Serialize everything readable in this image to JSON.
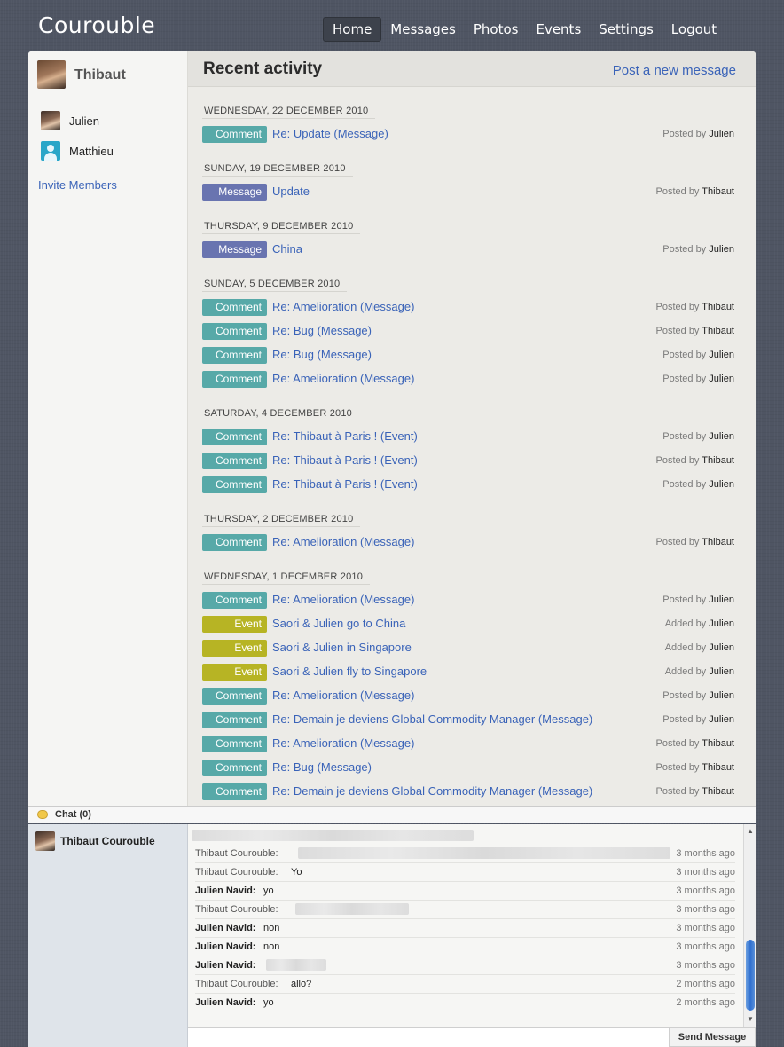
{
  "app": {
    "title": "Courouble"
  },
  "nav": [
    "Home",
    "Messages",
    "Photos",
    "Events",
    "Settings",
    "Logout"
  ],
  "nav_active": "Home",
  "sidebar": {
    "user": "Thibaut",
    "members": [
      "Julien",
      "Matthieu"
    ],
    "invite_label": "Invite Members"
  },
  "content": {
    "title": "Recent activity",
    "post_link": "Post a new message"
  },
  "days": [
    {
      "date": "WEDNESDAY, 22 DECEMBER 2010",
      "items": [
        {
          "type": "Comment",
          "title": "Re: Update (Message)",
          "verb": "Posted by",
          "author": "Julien"
        }
      ]
    },
    {
      "date": "SUNDAY, 19 DECEMBER 2010",
      "items": [
        {
          "type": "Message",
          "title": "Update",
          "verb": "Posted by",
          "author": "Thibaut"
        }
      ]
    },
    {
      "date": "THURSDAY, 9 DECEMBER 2010",
      "items": [
        {
          "type": "Message",
          "title": "China",
          "verb": "Posted by",
          "author": "Julien"
        }
      ]
    },
    {
      "date": "SUNDAY, 5 DECEMBER 2010",
      "items": [
        {
          "type": "Comment",
          "title": "Re: Amelioration (Message)",
          "verb": "Posted by",
          "author": "Thibaut"
        },
        {
          "type": "Comment",
          "title": "Re: Bug (Message)",
          "verb": "Posted by",
          "author": "Thibaut"
        },
        {
          "type": "Comment",
          "title": "Re: Bug (Message)",
          "verb": "Posted by",
          "author": "Julien"
        },
        {
          "type": "Comment",
          "title": "Re: Amelioration (Message)",
          "verb": "Posted by",
          "author": "Julien"
        }
      ]
    },
    {
      "date": "SATURDAY, 4 DECEMBER 2010",
      "items": [
        {
          "type": "Comment",
          "title": "Re: Thibaut à Paris ! (Event)",
          "verb": "Posted by",
          "author": "Julien"
        },
        {
          "type": "Comment",
          "title": "Re: Thibaut à Paris ! (Event)",
          "verb": "Posted by",
          "author": "Thibaut"
        },
        {
          "type": "Comment",
          "title": "Re: Thibaut à Paris ! (Event)",
          "verb": "Posted by",
          "author": "Julien"
        }
      ]
    },
    {
      "date": "THURSDAY, 2 DECEMBER 2010",
      "items": [
        {
          "type": "Comment",
          "title": "Re: Amelioration (Message)",
          "verb": "Posted by",
          "author": "Thibaut"
        }
      ]
    },
    {
      "date": "WEDNESDAY, 1 DECEMBER 2010",
      "items": [
        {
          "type": "Comment",
          "title": "Re: Amelioration (Message)",
          "verb": "Posted by",
          "author": "Julien"
        },
        {
          "type": "Event",
          "title": "Saori & Julien go to China",
          "verb": "Added by",
          "author": "Julien"
        },
        {
          "type": "Event",
          "title": "Saori & Julien in Singapore",
          "verb": "Added by",
          "author": "Julien"
        },
        {
          "type": "Event",
          "title": "Saori & Julien fly to Singapore",
          "verb": "Added by",
          "author": "Julien"
        },
        {
          "type": "Comment",
          "title": "Re: Amelioration (Message)",
          "verb": "Posted by",
          "author": "Julien"
        },
        {
          "type": "Comment",
          "title": "Re: Demain je deviens Global Commodity Manager (Message)",
          "verb": "Posted by",
          "author": "Julien"
        },
        {
          "type": "Comment",
          "title": "Re: Amelioration (Message)",
          "verb": "Posted by",
          "author": "Thibaut"
        },
        {
          "type": "Comment",
          "title": "Re: Bug (Message)",
          "verb": "Posted by",
          "author": "Thibaut"
        },
        {
          "type": "Comment",
          "title": "Re: Demain je deviens Global Commodity Manager (Message)",
          "verb": "Posted by",
          "author": "Thibaut"
        }
      ]
    }
  ],
  "chat": {
    "title": "Chat (0)",
    "online_user": "Thibaut Courouble",
    "messages": [
      {
        "from": "Thibaut Courouble:",
        "bold": false,
        "text": "",
        "time": "3 months ago"
      },
      {
        "from": "Thibaut Courouble:",
        "bold": false,
        "text": "Yo",
        "time": "3 months ago"
      },
      {
        "from": "Julien Navid:",
        "bold": true,
        "text": "yo",
        "time": "3 months ago"
      },
      {
        "from": "Thibaut Courouble:",
        "bold": false,
        "text": "",
        "time": "3 months ago"
      },
      {
        "from": "Julien Navid:",
        "bold": true,
        "text": "non",
        "time": "3 months ago"
      },
      {
        "from": "Julien Navid:",
        "bold": true,
        "text": "non",
        "time": "3 months ago"
      },
      {
        "from": "Julien Navid:",
        "bold": true,
        "text": "",
        "time": "3 months ago"
      },
      {
        "from": "Thibaut Courouble:",
        "bold": false,
        "text": "allo?",
        "time": "2 months ago"
      },
      {
        "from": "Julien Navid:",
        "bold": true,
        "text": "yo",
        "time": "2 months ago"
      }
    ],
    "send_label": "Send Message"
  },
  "colors": {
    "comment": "#57a9a8",
    "message": "#6974b0",
    "event": "#b7b424",
    "link": "#3a63b8",
    "background": "#4f5563"
  }
}
